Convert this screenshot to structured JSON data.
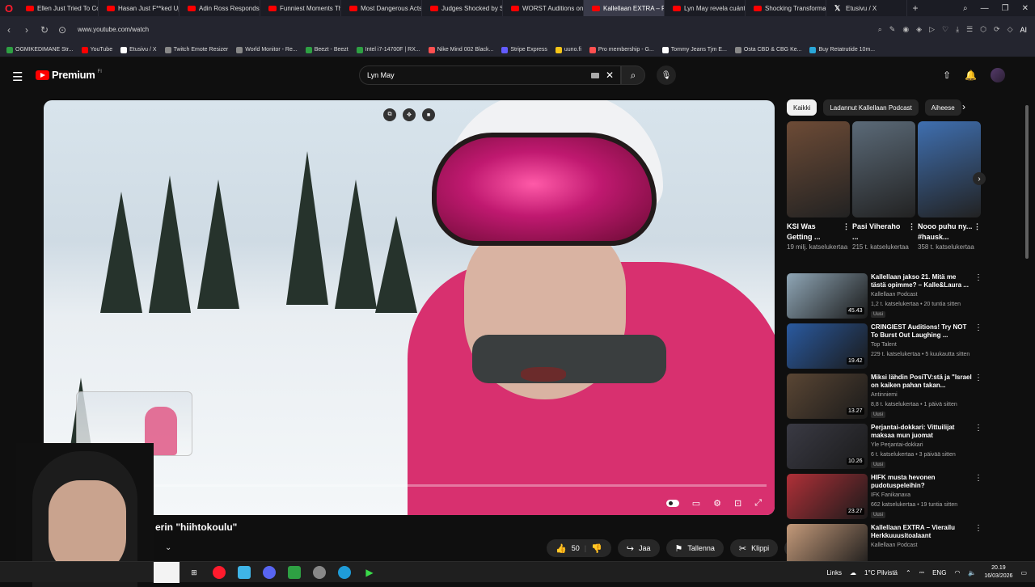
{
  "browser": {
    "tabs": [
      {
        "title": "Ellen Just Tried To Cor",
        "active": false,
        "icon": "youtube"
      },
      {
        "title": "Hasan Just F**ked Up",
        "active": false,
        "icon": "youtube"
      },
      {
        "title": "Adin Ross Responds t",
        "active": false,
        "icon": "youtube"
      },
      {
        "title": "Funniest Moments Th",
        "active": false,
        "icon": "youtube"
      },
      {
        "title": "Most Dangerous Acts",
        "active": false,
        "icon": "youtube"
      },
      {
        "title": "Judges Shocked by Sc",
        "active": false,
        "icon": "youtube"
      },
      {
        "title": "WORST Auditions on",
        "active": false,
        "icon": "youtube"
      },
      {
        "title": "Kallellaan EXTRA – Pal",
        "active": true,
        "icon": "youtube"
      },
      {
        "title": "Lyn May revela cuánt",
        "active": false,
        "icon": "youtube"
      },
      {
        "title": "Shocking Transforma",
        "active": false,
        "icon": "youtube"
      },
      {
        "title": "Etusivu / X",
        "active": false,
        "icon": "x"
      }
    ],
    "new_tab": "+",
    "url": "www.youtube.com/watch",
    "ai_label": "AI",
    "bookmarks": [
      {
        "label": "OGMIKEDIMANE Str...",
        "color": "#2ea043"
      },
      {
        "label": "YouTube",
        "color": "#ff0000"
      },
      {
        "label": "Etusivu / X",
        "color": "#ffffff"
      },
      {
        "label": "Twitch Emote Resizer",
        "color": "#888888"
      },
      {
        "label": "World Monitor - Re...",
        "color": "#888888"
      },
      {
        "label": "Beezt - Beezt",
        "color": "#2ea043"
      },
      {
        "label": "Intel i7-14700F | RX...",
        "color": "#2ea043"
      },
      {
        "label": "Nike Mind 002 Black...",
        "color": "#ff5050"
      },
      {
        "label": "Stripe Express",
        "color": "#635bff"
      },
      {
        "label": "uuno.fi",
        "color": "#f5c518"
      },
      {
        "label": "Pro membership - G...",
        "color": "#ff5050"
      },
      {
        "label": "Tommy Jeans Tjm E...",
        "color": "#ffffff"
      },
      {
        "label": "Osta CBD & CBG Ke...",
        "color": "#888888"
      },
      {
        "label": "Buy Retatrutide 10m...",
        "color": "#2aa7d8"
      }
    ]
  },
  "youtube": {
    "logo_text": "Premium",
    "logo_region": "FI",
    "search_value": "Lyn May",
    "video": {
      "progress_fraction": 0.11,
      "title_partial": "erin \"hiihtokoulu\""
    },
    "actions": {
      "like_count": "50",
      "share_label": "Jaa",
      "save_label": "Tallenna",
      "clip_label": "Klippi"
    },
    "chips": [
      "Kaikki",
      "Ladannut Kallellaan Podcast",
      "Aiheese"
    ],
    "shorts": [
      {
        "title": "KSI Was Getting ...",
        "views": "19 milj. katselukertaa",
        "color": "#6d4b36"
      },
      {
        "title": "Pasi Viheraho ...",
        "views": "215 t. katselukertaa",
        "color": "#5b6a78"
      },
      {
        "title": "Nooo puhu ny... #hausk...",
        "views": "358 t. katselukertaa",
        "color": "#3f6fb0"
      }
    ],
    "related": [
      {
        "title": "Kallellaan jakso 21. Mitä me tästä opimme? – Kalle&Laura ...",
        "channel": "Kallellaan Podcast",
        "meta": "1,2 t. katselukertaa • 20 tuntia sitten",
        "duration": "45.43",
        "badge": "Uusi",
        "color": "#8fa6b6"
      },
      {
        "title": "CRINGIEST Auditions! Try NOT To Burst Out Laughing ...",
        "channel": "Top Talent",
        "meta": "229 t. katselukertaa • 5 kuukautta sitten",
        "duration": "19.42",
        "badge": "",
        "color": "#2a5aa0"
      },
      {
        "title": "Miksi lähdin PosiTV:stä ja \"Israel on kaiken pahan takan...",
        "channel": "Antinniemi",
        "meta": "8,8 t. katselukertaa • 1 päivä sitten",
        "duration": "13.27",
        "badge": "Uusi",
        "color": "#5a4634"
      },
      {
        "title": "Perjantai-dokkari: Vittuilijat maksaa mun juomat",
        "channel": "Yle Perjantai-dokkari",
        "meta": "6 t. katselukertaa • 3 päivää sitten",
        "duration": "10.26",
        "badge": "Uusi",
        "color": "#3a3a44"
      },
      {
        "title": "HIFK musta hevonen pudotuspeleihin?",
        "channel": "IFK Fanikanava",
        "meta": "662 katselukertaa • 19 tuntia sitten",
        "duration": "23.27",
        "badge": "Uusi",
        "color": "#b03038"
      },
      {
        "title": "Kallellaan EXTRA – Vierailu Herkkuuusitoalaant",
        "channel": "Kallellaan Podcast",
        "meta": "",
        "duration": "",
        "badge": "",
        "color": "#c49a7a"
      }
    ]
  },
  "taskbar": {
    "links_label": "Links",
    "weather": "1°C Pilvistä",
    "lang": "ENG",
    "time": "20.19",
    "date": "16/03/2026"
  }
}
